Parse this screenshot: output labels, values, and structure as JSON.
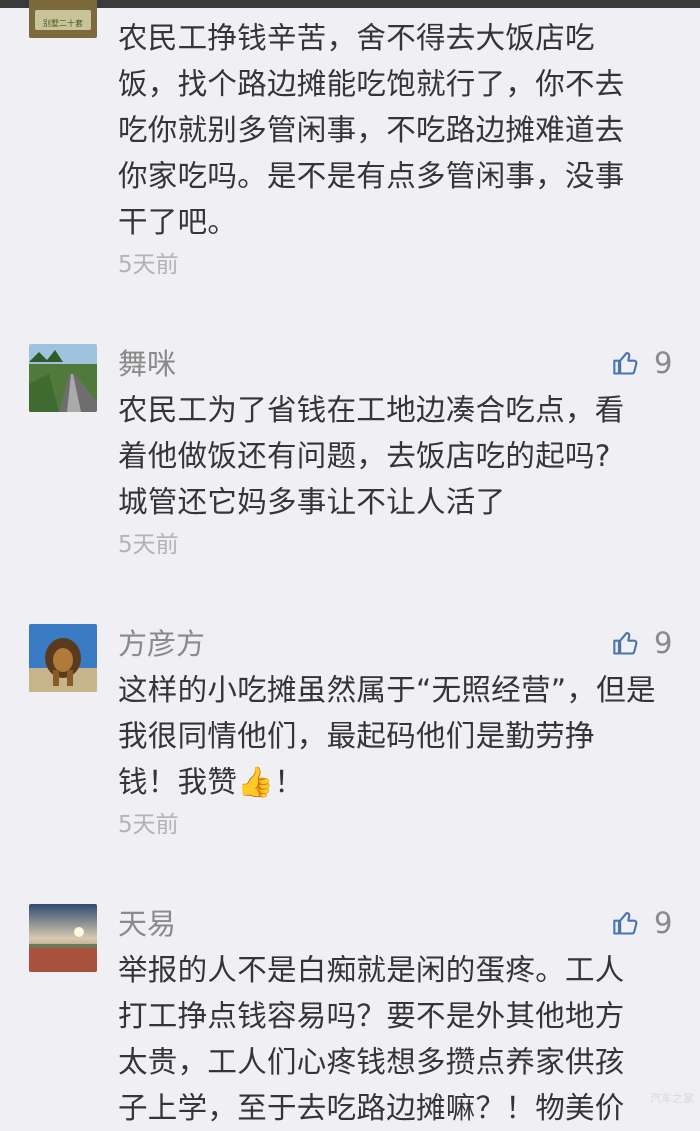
{
  "comments": [
    {
      "name": "",
      "likes": "",
      "lines": [
        "农民工挣钱辛苦，舍不得去大饭店吃",
        "饭，找个路边摊能吃饱就行了，你不去",
        "吃你就别多管闲事，不吃路边摊难道去",
        "你家吃吗。是不是有点多管闲事，没事",
        "干了吧。"
      ],
      "time": "5天前",
      "avatar_badge": "别墅二十套"
    },
    {
      "name": "舞咪",
      "likes": "9",
      "lines": [
        "农民工为了省钱在工地边凑合吃点，看",
        "着他做饭还有问题，去饭店吃的起吗?",
        "城管还它妈多事让不让人活了"
      ],
      "time": "5天前"
    },
    {
      "name": "方彦方",
      "likes": "9",
      "lines": [
        "这样的小吃摊虽然属于“无照经营”，但是",
        "我很同情他们，最起码他们是勤劳挣",
        "钱！我赞👍！"
      ],
      "time": "5天前"
    },
    {
      "name": "天易",
      "likes": "9",
      "lines": [
        "举报的人不是白痴就是闲的蛋疼。工人",
        "打工挣点钱容易吗？要不是外其他地方",
        "太贵，工人们心疼钱想多攒点养家供孩",
        "子上学，至于去吃路边摊嘛？！物美价"
      ],
      "time": ""
    }
  ],
  "watermark": "汽车之家",
  "colors": {
    "background": "#efeff4",
    "text": "#353535",
    "meta": "#8a8a8a",
    "time": "#b3b3b3",
    "accent": "#4a74b0"
  }
}
